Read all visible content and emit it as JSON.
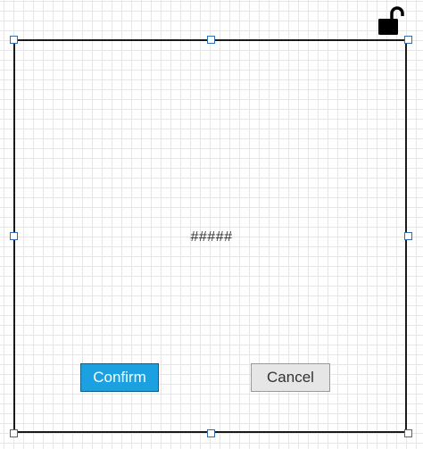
{
  "dialog": {
    "placeholder_text": "#####",
    "confirm_label": "Confirm",
    "cancel_label": "Cancel"
  },
  "icons": {
    "lock": "unlocked-padlock-icon"
  },
  "colors": {
    "confirm_bg": "#1ba1e2",
    "cancel_bg": "#e6e6e6",
    "handle_border": "#2a6fb5",
    "frame_border": "#1a1a1a"
  }
}
